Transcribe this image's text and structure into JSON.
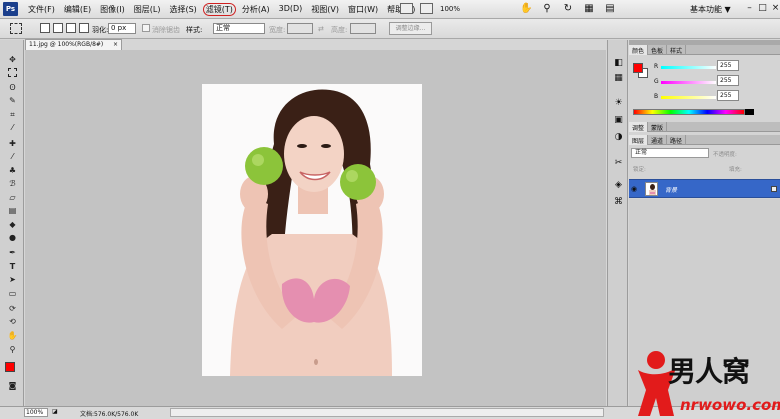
{
  "app": {
    "logo": "Ps"
  },
  "menu": [
    "文件(F)",
    "编辑(E)",
    "图像(I)",
    "图层(L)",
    "选择(S)",
    "滤镜(T)",
    "分析(A)",
    "3D(D)",
    "视图(V)",
    "窗口(W)",
    "帮助(H)"
  ],
  "menubar": {
    "zoom": "100%",
    "workspace": "基本功能",
    "workspace_arrow": "▼",
    "win_min": "–",
    "win_max": "□",
    "win_close": "×"
  },
  "options": {
    "feather_label": "羽化:",
    "feather_value": "0 px",
    "antialias_label": "消除锯齿",
    "style_label": "样式:",
    "style_value": "正常",
    "width_label": "宽度:",
    "height_label": "高度:",
    "refine_label": "调整边缘..."
  },
  "document": {
    "tab_title": "11.jpg @ 100%(RGB/8#)",
    "tab_close": "×"
  },
  "status": {
    "zoom": "100%",
    "doc_info": "文档:576.0K/576.0K"
  },
  "color_panel": {
    "tabs": [
      "颜色",
      "色板",
      "样式"
    ],
    "r_label": "R",
    "g_label": "G",
    "b_label": "B",
    "r": "255",
    "g": "255",
    "b": "255",
    "fg_color": "#ff0000",
    "bg_color": "#ffffff"
  },
  "adjust_panel": {
    "tabs": [
      "调整",
      "蒙版"
    ]
  },
  "layers_panel": {
    "tabs": [
      "图层",
      "通道",
      "路径"
    ],
    "blend_mode": "正常",
    "opacity_label": "不透明度:",
    "lock_label": "锁定:",
    "fill_label": "填充:",
    "layer_name": "背景",
    "selected_color": "#3667c8"
  },
  "watermark": {
    "brand": "男人窝",
    "url": "nrwowo.com"
  }
}
